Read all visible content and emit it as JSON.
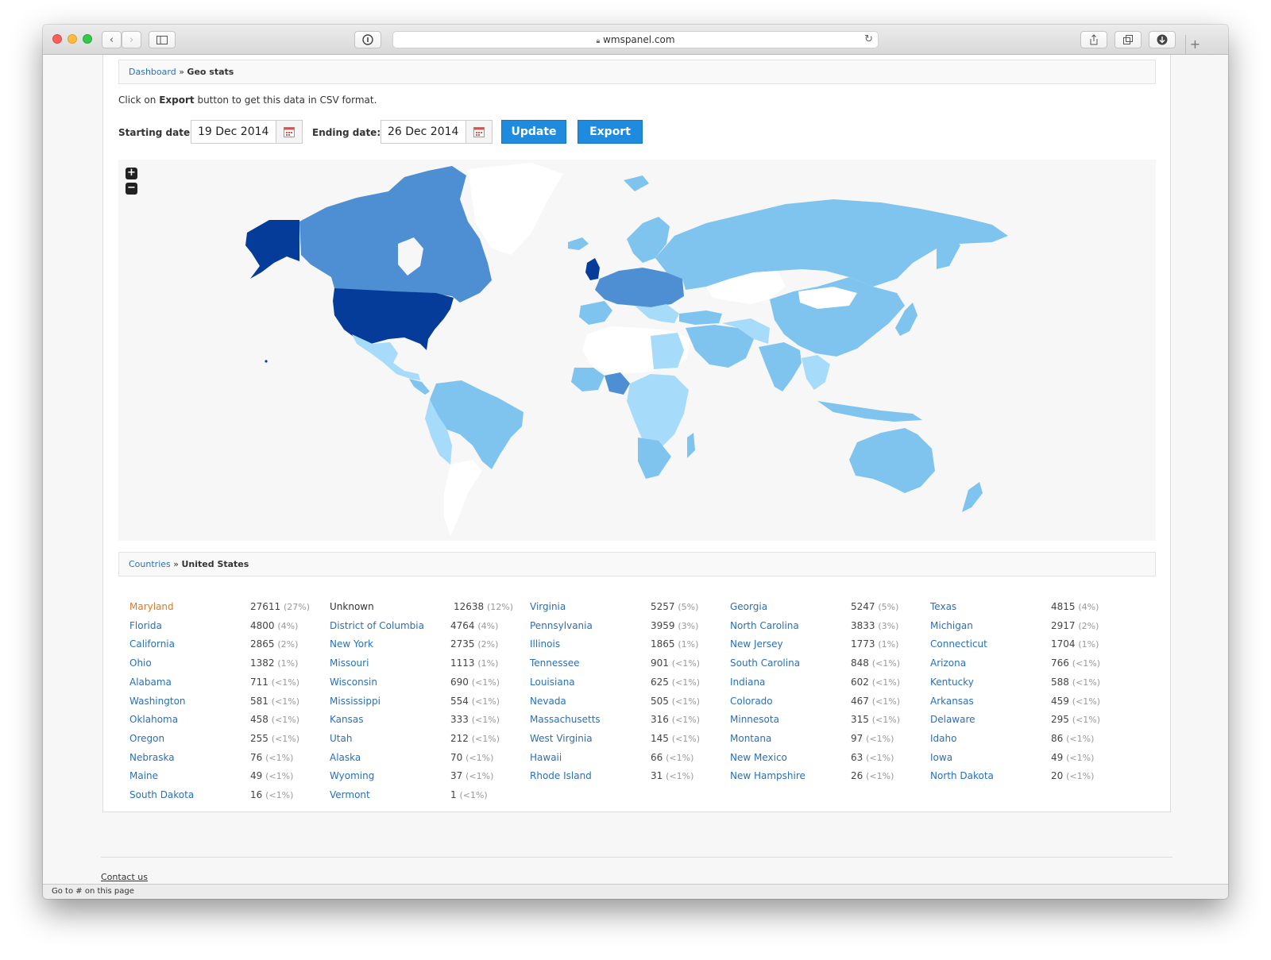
{
  "browser": {
    "url": "wmspanel.com",
    "status_bar": "Go to # on this page"
  },
  "breadcrumb": {
    "link": "Dashboard",
    "separator": "»",
    "current": "Geo stats"
  },
  "info": {
    "prefix": "Click on",
    "bold": "Export",
    "suffix": "button to get this data in CSV format."
  },
  "filters": {
    "start_label": "Starting date:",
    "start_value": "19 Dec 2014",
    "end_label": "Ending date:",
    "end_value": "26 Dec 2014",
    "update_label": "Update",
    "export_label": "Export"
  },
  "map": {
    "zoom_in": "+",
    "zoom_out": "−",
    "colors": {
      "ocean": "#f7f7f7",
      "no_data": "#ffffff",
      "level1": "#a6dbf9",
      "level2": "#7fc4ee",
      "level3": "#4e8fd4",
      "level4": "#053b99"
    }
  },
  "countries_crumb": {
    "link": "Countries",
    "separator": "»",
    "current": "United States"
  },
  "states": [
    {
      "name": "Maryland",
      "value": "27611",
      "pct": "(27%)",
      "highlight": true
    },
    {
      "name": "Unknown",
      "value": "12638",
      "pct": "(12%)",
      "plain": true
    },
    {
      "name": "Virginia",
      "value": "5257",
      "pct": "(5%)"
    },
    {
      "name": "Georgia",
      "value": "5247",
      "pct": "(5%)"
    },
    {
      "name": "Texas",
      "value": "4815",
      "pct": "(4%)"
    },
    {
      "name": "Florida",
      "value": "4800",
      "pct": "(4%)"
    },
    {
      "name": "District of Columbia",
      "value": "4764",
      "pct": "(4%)"
    },
    {
      "name": "Pennsylvania",
      "value": "3959",
      "pct": "(3%)"
    },
    {
      "name": "North Carolina",
      "value": "3833",
      "pct": "(3%)"
    },
    {
      "name": "Michigan",
      "value": "2917",
      "pct": "(2%)"
    },
    {
      "name": "California",
      "value": "2865",
      "pct": "(2%)"
    },
    {
      "name": "New York",
      "value": "2735",
      "pct": "(2%)"
    },
    {
      "name": "Illinois",
      "value": "1865",
      "pct": "(1%)"
    },
    {
      "name": "New Jersey",
      "value": "1773",
      "pct": "(1%)"
    },
    {
      "name": "Connecticut",
      "value": "1704",
      "pct": "(1%)"
    },
    {
      "name": "Ohio",
      "value": "1382",
      "pct": "(1%)"
    },
    {
      "name": "Missouri",
      "value": "1113",
      "pct": "(1%)"
    },
    {
      "name": "Tennessee",
      "value": "901",
      "pct": "(<1%)"
    },
    {
      "name": "South Carolina",
      "value": "848",
      "pct": "(<1%)"
    },
    {
      "name": "Arizona",
      "value": "766",
      "pct": "(<1%)"
    },
    {
      "name": "Alabama",
      "value": "711",
      "pct": "(<1%)"
    },
    {
      "name": "Wisconsin",
      "value": "690",
      "pct": "(<1%)"
    },
    {
      "name": "Louisiana",
      "value": "625",
      "pct": "(<1%)"
    },
    {
      "name": "Indiana",
      "value": "602",
      "pct": "(<1%)"
    },
    {
      "name": "Kentucky",
      "value": "588",
      "pct": "(<1%)"
    },
    {
      "name": "Washington",
      "value": "581",
      "pct": "(<1%)"
    },
    {
      "name": "Mississippi",
      "value": "554",
      "pct": "(<1%)"
    },
    {
      "name": "Nevada",
      "value": "505",
      "pct": "(<1%)"
    },
    {
      "name": "Colorado",
      "value": "467",
      "pct": "(<1%)"
    },
    {
      "name": "Arkansas",
      "value": "459",
      "pct": "(<1%)"
    },
    {
      "name": "Oklahoma",
      "value": "458",
      "pct": "(<1%)"
    },
    {
      "name": "Kansas",
      "value": "333",
      "pct": "(<1%)"
    },
    {
      "name": "Massachusetts",
      "value": "316",
      "pct": "(<1%)"
    },
    {
      "name": "Minnesota",
      "value": "315",
      "pct": "(<1%)"
    },
    {
      "name": "Delaware",
      "value": "295",
      "pct": "(<1%)"
    },
    {
      "name": "Oregon",
      "value": "255",
      "pct": "(<1%)"
    },
    {
      "name": "Utah",
      "value": "212",
      "pct": "(<1%)"
    },
    {
      "name": "West Virginia",
      "value": "145",
      "pct": "(<1%)"
    },
    {
      "name": "Montana",
      "value": "97",
      "pct": "(<1%)"
    },
    {
      "name": "Idaho",
      "value": "86",
      "pct": "(<1%)"
    },
    {
      "name": "Nebraska",
      "value": "76",
      "pct": "(<1%)"
    },
    {
      "name": "Alaska",
      "value": "70",
      "pct": "(<1%)"
    },
    {
      "name": "Hawaii",
      "value": "66",
      "pct": "(<1%)"
    },
    {
      "name": "New Mexico",
      "value": "63",
      "pct": "(<1%)"
    },
    {
      "name": "Iowa",
      "value": "49",
      "pct": "(<1%)"
    },
    {
      "name": "Maine",
      "value": "49",
      "pct": "(<1%)"
    },
    {
      "name": "Wyoming",
      "value": "37",
      "pct": "(<1%)"
    },
    {
      "name": "Rhode Island",
      "value": "31",
      "pct": "(<1%)"
    },
    {
      "name": "New Hampshire",
      "value": "26",
      "pct": "(<1%)"
    },
    {
      "name": "North Dakota",
      "value": "20",
      "pct": "(<1%)"
    },
    {
      "name": "South Dakota",
      "value": "16",
      "pct": "(<1%)"
    },
    {
      "name": "Vermont",
      "value": "1",
      "pct": "(<1%)"
    }
  ],
  "footer": {
    "contact": "Contact us"
  }
}
